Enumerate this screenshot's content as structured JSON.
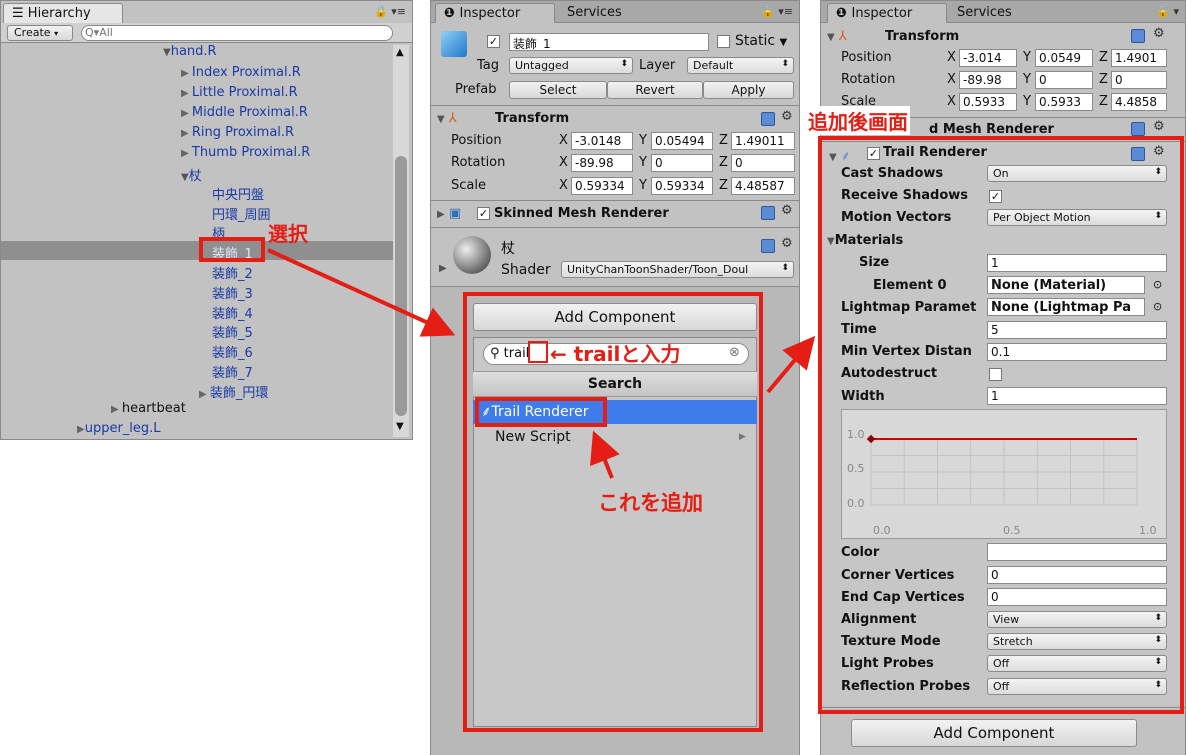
{
  "hierarchy": {
    "tab": "Hierarchy",
    "create_label": "Create",
    "search_placeholder": "All",
    "items": [
      {
        "label": "hand.R"
      },
      {
        "label": "Index Proximal.R"
      },
      {
        "label": "Little Proximal.R"
      },
      {
        "label": "Middle Proximal.R"
      },
      {
        "label": "Ring Proximal.R"
      },
      {
        "label": "Thumb Proximal.R"
      },
      {
        "label": "杖"
      },
      {
        "label": "中央円盤"
      },
      {
        "label": "円環_周囲"
      },
      {
        "label": "柄"
      },
      {
        "label": "装飾_1"
      },
      {
        "label": "装飾_2"
      },
      {
        "label": "装飾_3"
      },
      {
        "label": "装飾_4"
      },
      {
        "label": "装飾_5"
      },
      {
        "label": "装飾_6"
      },
      {
        "label": "装飾_7"
      },
      {
        "label": "装飾_円環"
      },
      {
        "label": "heartbeat"
      },
      {
        "label": "upper_leg.L"
      }
    ]
  },
  "inspector1": {
    "tabs": [
      "Inspector",
      "Services"
    ],
    "object_name": "装飾_1",
    "static_label": "Static",
    "tag_label": "Tag",
    "tag_value": "Untagged",
    "layer_label": "Layer",
    "layer_value": "Default",
    "prefab_label": "Prefab",
    "prefab_select": "Select",
    "prefab_revert": "Revert",
    "prefab_apply": "Apply",
    "transform_title": "Transform",
    "position_label": "Position",
    "rotation_label": "Rotation",
    "scale_label": "Scale",
    "position": [
      "-3.0148",
      "0.05494",
      "1.49011"
    ],
    "rotation": [
      "-89.98",
      "0",
      "0"
    ],
    "scale": [
      "0.59334",
      "0.59334",
      "4.48587"
    ],
    "skinned_title": "Skinned Mesh Renderer",
    "material_name": "杖",
    "shader_label": "Shader",
    "shader_value": "UnityChanToonShader/Toon_Doul",
    "add_component": "Add Component",
    "search_value": "trail",
    "search_header": "Search",
    "results": [
      "Trail Renderer",
      "New Script"
    ]
  },
  "inspector2": {
    "tabs": [
      "Inspector",
      "Services"
    ],
    "transform_title": "Transform",
    "position_label": "Position",
    "rotation_label": "Rotation",
    "scale_label": "Scale",
    "position": [
      "-3.014",
      "0.0549",
      "1.4901"
    ],
    "rotation": [
      "-89.98",
      "0",
      "0"
    ],
    "scale": [
      "0.5933",
      "0.5933",
      "4.4858"
    ],
    "hidden_title": "d Mesh Renderer",
    "trail_title": "Trail Renderer",
    "props": [
      {
        "label": "Cast Shadows",
        "value": "On",
        "kind": "drop"
      },
      {
        "label": "Receive Shadows",
        "value": "✓",
        "kind": "check"
      },
      {
        "label": "Motion Vectors",
        "value": "Per Object Motion",
        "kind": "drop"
      },
      {
        "label": "Materials",
        "value": "",
        "kind": "fold"
      },
      {
        "label": "Size",
        "value": "1",
        "kind": "field"
      },
      {
        "label": "Element 0",
        "value": "None (Material)",
        "kind": "obj"
      },
      {
        "label": "Lightmap Paramet",
        "value": "None (Lightmap Pa",
        "kind": "obj"
      },
      {
        "label": "Time",
        "value": "5",
        "kind": "field"
      },
      {
        "label": "Min Vertex Distan",
        "value": "0.1",
        "kind": "field"
      },
      {
        "label": "Autodestruct",
        "value": "",
        "kind": "check"
      },
      {
        "label": "Width",
        "value": "1",
        "kind": "field"
      }
    ],
    "curve": {
      "y_ticks": [
        "1.0",
        "0.5",
        "0.0"
      ],
      "x_ticks": [
        "0.0",
        "0.5",
        "1.0"
      ],
      "value": 1.0
    },
    "props2": [
      {
        "label": "Color",
        "value": "",
        "kind": "color"
      },
      {
        "label": "Corner Vertices",
        "value": "0",
        "kind": "field"
      },
      {
        "label": "End Cap Vertices",
        "value": "0",
        "kind": "field"
      },
      {
        "label": "Alignment",
        "value": "View",
        "kind": "drop"
      },
      {
        "label": "Texture Mode",
        "value": "Stretch",
        "kind": "drop"
      },
      {
        "label": "Light Probes",
        "value": "Off",
        "kind": "drop"
      },
      {
        "label": "Reflection Probes",
        "value": "Off",
        "kind": "drop"
      }
    ],
    "add_component": "Add Component"
  },
  "annotations": {
    "select": "選択",
    "type_trail": "trailと入力",
    "add_this": "これを追加",
    "after_add": "追加後画面"
  },
  "colors": {
    "accent_red": "#e41e14",
    "selection_blue": "#3d7cea",
    "label_blue": "#1a3aa6"
  }
}
